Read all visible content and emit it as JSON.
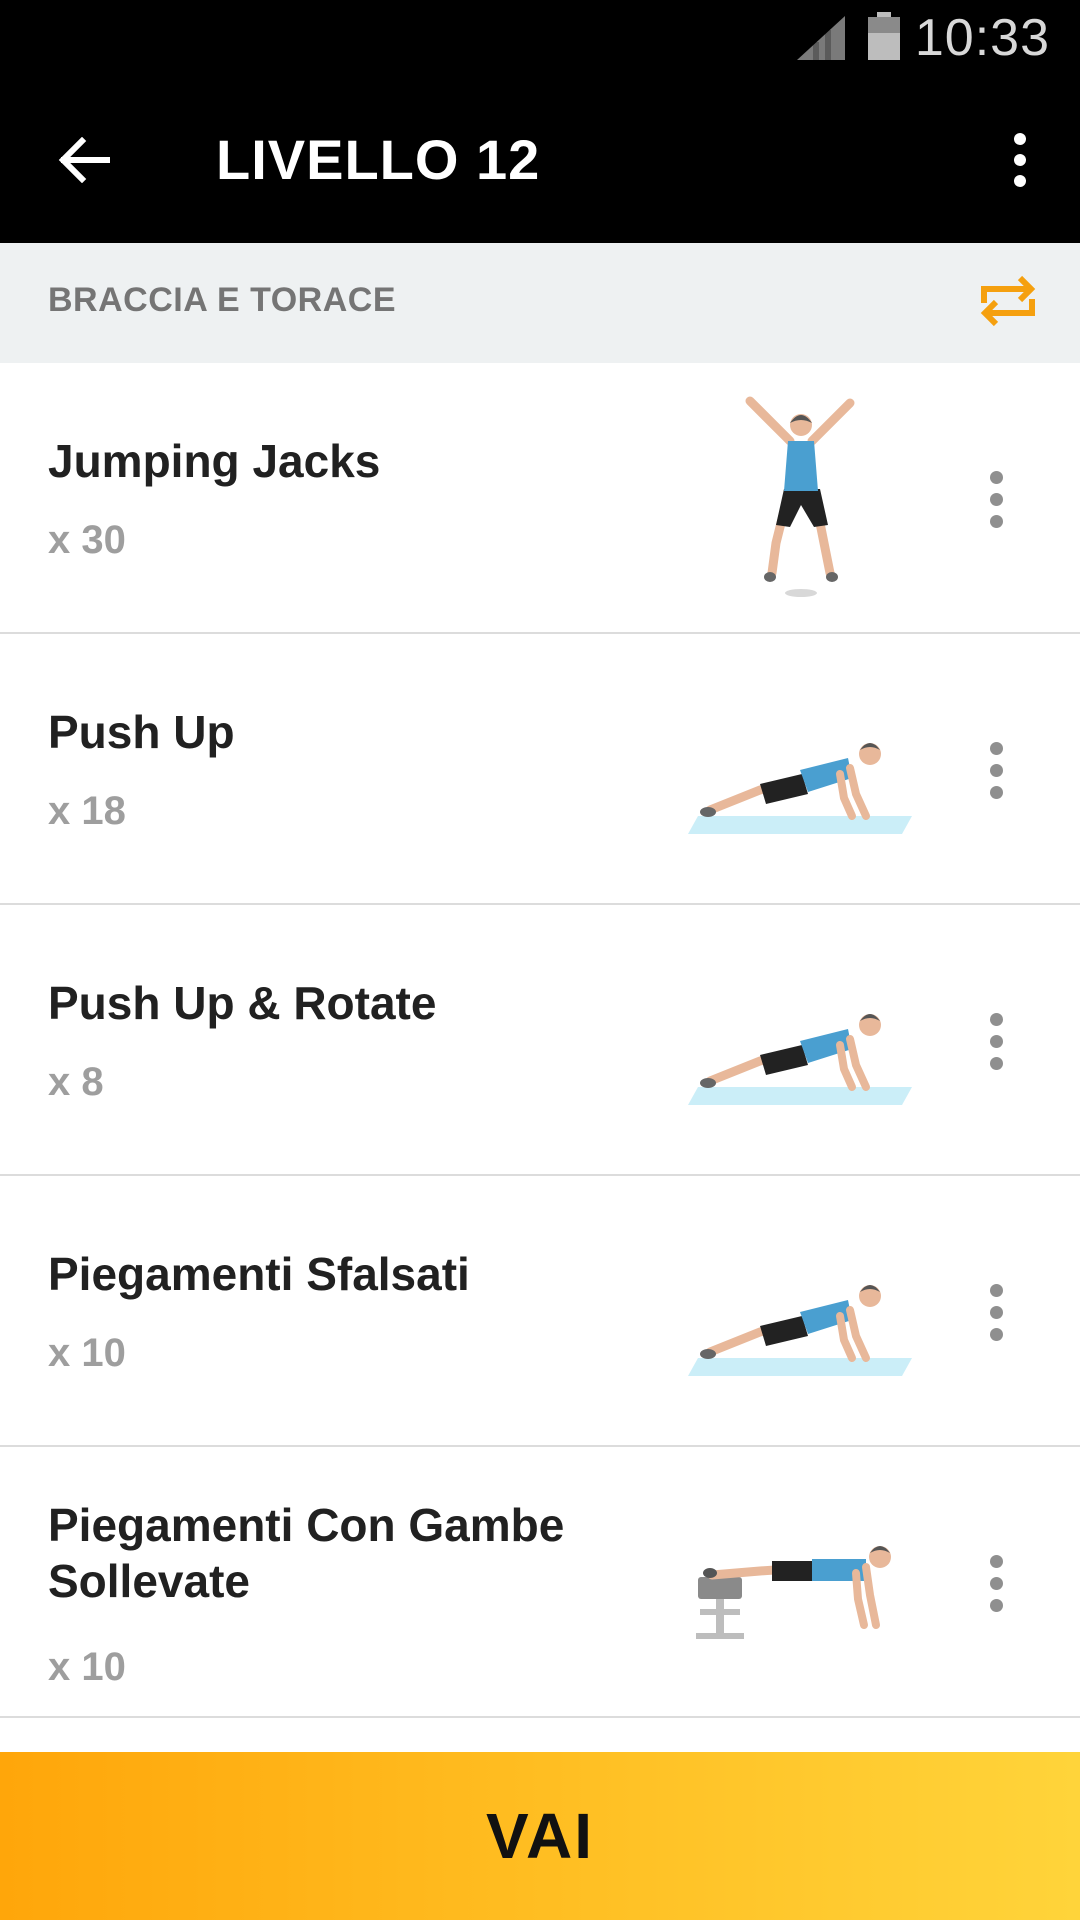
{
  "status_bar": {
    "time": "10:33"
  },
  "app_bar": {
    "title": "LIVELLO 12",
    "back_icon": "arrow-left-icon",
    "menu_icon": "more-vert-icon"
  },
  "section": {
    "title": "BRACCIA E TORACE",
    "action_icon": "repeat-icon",
    "accent_color": "#f5a00f"
  },
  "exercises": [
    {
      "name": "Jumping Jacks",
      "reps": "x 30",
      "illustration": "jumping-jacks"
    },
    {
      "name": "Push Up",
      "reps": "x 18",
      "illustration": "push-up"
    },
    {
      "name": "Push Up & Rotate",
      "reps": "x 8",
      "illustration": "push-up"
    },
    {
      "name": "Piegamenti Sfalsati",
      "reps": "x 10",
      "illustration": "push-up"
    },
    {
      "name": "Piegamenti Con Gambe Sollevate",
      "reps": "x 10",
      "illustration": "decline-push-up"
    }
  ],
  "start_button": {
    "label": "VAI"
  },
  "colors": {
    "app_bar": "#000000",
    "section_bg": "#eef1f2",
    "cta_start": "#ffa60a",
    "cta_end": "#ffd43a",
    "shirt": "#4a9fd0",
    "mat": "#cbeef8"
  }
}
